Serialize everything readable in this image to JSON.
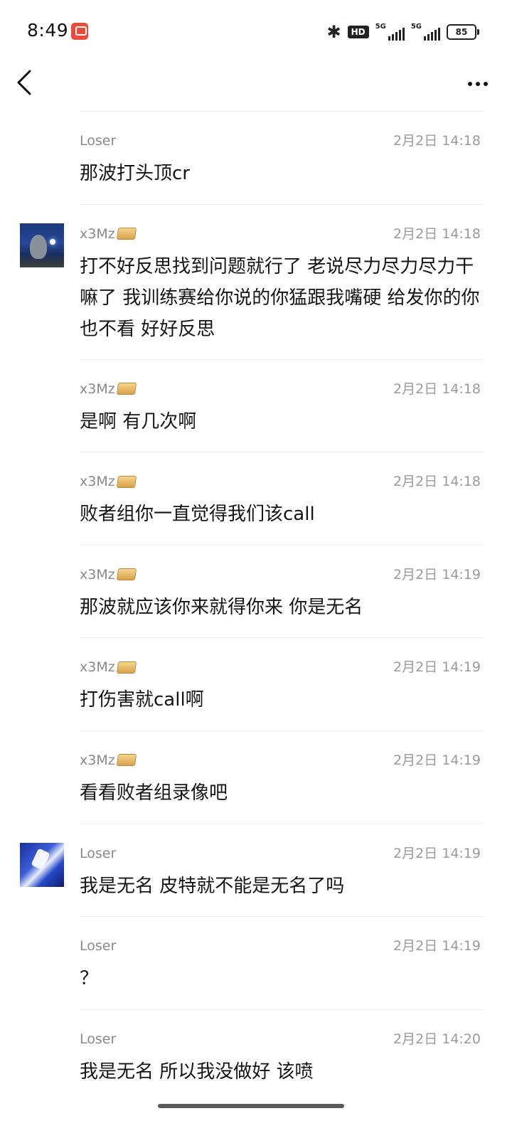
{
  "status_bar": {
    "time": "8:49",
    "hd_label": "HD",
    "signal_1_label": "5G",
    "signal_2_label": "5G",
    "battery": "85"
  },
  "nav": {
    "back_icon": "chevron-left-icon",
    "more_icon": "more-dots-icon"
  },
  "messages": [
    {
      "sender": "Loser",
      "time": "2月2日 14:18",
      "text": "那波打头顶cr",
      "avatar": ""
    },
    {
      "sender": "x3Mz",
      "time": "2月2日 14:18",
      "text": "打不好反思找到问题就行了 老说尽力尽力尽力干嘛了 我训练赛给你说的你猛跟我嘴硬 给发你的你也不看 好好反思",
      "avatar": "totoro"
    },
    {
      "sender": "x3Mz",
      "time": "2月2日 14:18",
      "text": "是啊 有几次啊",
      "avatar": ""
    },
    {
      "sender": "x3Mz",
      "time": "2月2日 14:18",
      "text": "败者组你一直觉得我们该call",
      "avatar": ""
    },
    {
      "sender": "x3Mz",
      "time": "2月2日 14:19",
      "text": "那波就应该你来就得你来 你是无名",
      "avatar": ""
    },
    {
      "sender": "x3Mz",
      "time": "2月2日 14:19",
      "text": "打伤害就call啊",
      "avatar": ""
    },
    {
      "sender": "x3Mz",
      "time": "2月2日 14:19",
      "text": "看看败者组录像吧",
      "avatar": ""
    },
    {
      "sender": "Loser",
      "time": "2月2日 14:19",
      "text": "我是无名 皮特就不能是无名了吗",
      "avatar": "blue"
    },
    {
      "sender": "Loser",
      "time": "2月2日 14:19",
      "text": "？",
      "avatar": ""
    },
    {
      "sender": "Loser",
      "time": "2月2日 14:20",
      "text": "我是无名 所以我没做好 该喷",
      "avatar": ""
    }
  ]
}
